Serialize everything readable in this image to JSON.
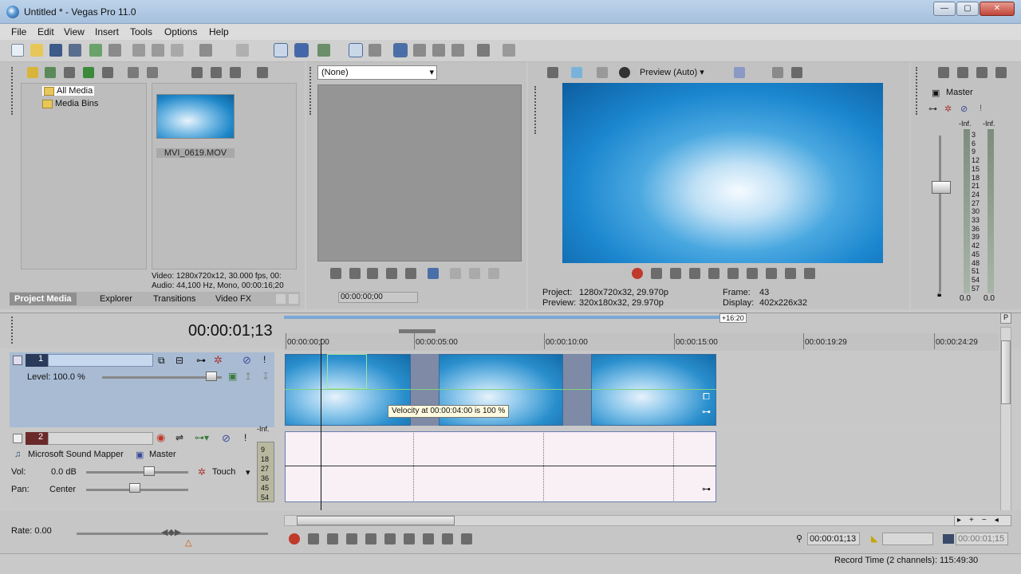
{
  "window": {
    "title": "Untitled * - Vegas Pro 11.0",
    "minimize": "—",
    "maximize": "▢",
    "close": "✕"
  },
  "menu": [
    "File",
    "Edit",
    "View",
    "Insert",
    "Tools",
    "Options",
    "Help"
  ],
  "project_media": {
    "tree": {
      "all_media": "All Media",
      "media_bins": "Media Bins"
    },
    "file_name": "MVI_0619.MOV",
    "info_video": "Video: 1280x720x12, 30.000 fps, 00:",
    "info_audio": "Audio: 44,100 Hz, Mono, 00:00:16;20",
    "tabs": [
      "Project Media",
      "Explorer",
      "Transitions",
      "Video FX"
    ]
  },
  "trimmer": {
    "dropdown_value": "(None)",
    "timecode": "00:00:00;00"
  },
  "preview": {
    "mode_label": "Preview (Auto)",
    "project_label": "Project:",
    "project_value": "1280x720x32, 29.970p",
    "preview_label": "Preview:",
    "preview_value": "320x180x32, 29.970p",
    "frame_label": "Frame:",
    "frame_value": "43",
    "display_label": "Display:",
    "display_value": "402x226x32"
  },
  "mixer": {
    "title": "Master",
    "inf_left": "-Inf.",
    "inf_right": "-Inf.",
    "scale": [
      "3",
      "6",
      "9",
      "12",
      "15",
      "18",
      "21",
      "24",
      "27",
      "30",
      "33",
      "36",
      "39",
      "42",
      "45",
      "48",
      "51",
      "54",
      "57"
    ],
    "bottom_left": "0.0",
    "bottom_right": "0.0"
  },
  "timeline": {
    "cursor_time": "00:00:01;13",
    "length_badge": "+16:20",
    "ruler": [
      "00:00:00;00",
      "00:00:05:00",
      "00:00:10:00",
      "00:00:15:00",
      "00:00:19:29",
      "00:00:24:29"
    ],
    "tooltip": "Velocity at 00:00:04:00 is 100 %",
    "rate_label": "Rate: 0.00",
    "position": "00:00:01;13",
    "position_end": "00:00:01;15"
  },
  "track1": {
    "number": "1",
    "level_label": "Level: 100.0 %"
  },
  "track2": {
    "number": "2",
    "device": "Microsoft Sound Mapper",
    "bus": "Master",
    "vol_label": "Vol:",
    "vol_value": "0.0 dB",
    "automation": "Touch",
    "pan_label": "Pan:",
    "pan_value": "Center",
    "meter_top": "-Inf.",
    "meter_scale": [
      "9",
      "18",
      "27",
      "36",
      "45",
      "54"
    ]
  },
  "status": {
    "record_time": "Record Time (2 channels): 115:49:30"
  },
  "colors": {
    "accent": "#4c6e98",
    "track_header": "#a8bbd3",
    "record": "#c0392b"
  }
}
